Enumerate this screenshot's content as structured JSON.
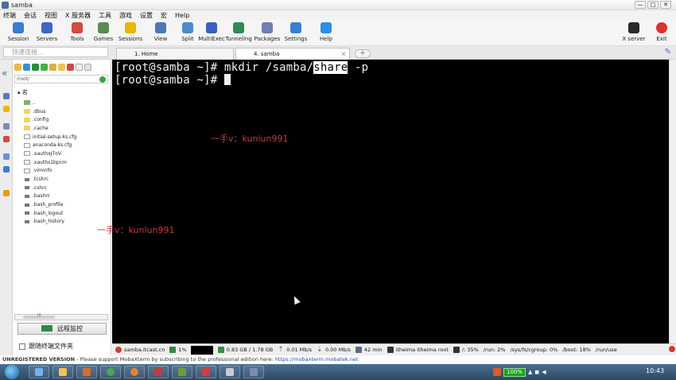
{
  "window": {
    "title": "samba",
    "minimize": "—",
    "maximize": "□",
    "close": "✕"
  },
  "menu": [
    "终端",
    "会话",
    "视图",
    "X 服务器",
    "工具",
    "游戏",
    "设置",
    "宏",
    "Help"
  ],
  "toolbar": {
    "items": [
      {
        "label": "Session",
        "color": "#3a7bd5"
      },
      {
        "label": "Servers",
        "color": "#3f66c8"
      },
      {
        "label": "Tools",
        "color": "#d24b3b"
      },
      {
        "label": "Games",
        "color": "#5a8a52"
      },
      {
        "label": "Sessions",
        "color": "#f0b400"
      },
      {
        "label": "View",
        "color": "#4d77b8"
      },
      {
        "label": "Split",
        "color": "#4a8bd0"
      },
      {
        "label": "MultiExec",
        "color": "#3d5ec2"
      },
      {
        "label": "Tunneling",
        "color": "#2e8b57"
      },
      {
        "label": "Packages",
        "color": "#6d7fb5"
      },
      {
        "label": "Settings",
        "color": "#3b7ed3"
      },
      {
        "label": "Help",
        "color": "#2c8ee8"
      }
    ],
    "right": [
      {
        "label": "X server",
        "color": "#2a2a2a"
      },
      {
        "label": "Exit",
        "color": "#e0312a"
      }
    ]
  },
  "quick_connect": {
    "placeholder": "快速连接..."
  },
  "tabs": [
    {
      "label": "1. Home",
      "active": false
    },
    {
      "label": "4. samba",
      "active": true,
      "close": "×"
    }
  ],
  "sidebar": {
    "path": "/root/",
    "column": "名",
    "files": [
      {
        "name": "..",
        "type": "up"
      },
      {
        "name": ".dbus",
        "type": "folder"
      },
      {
        "name": ".config",
        "type": "folder"
      },
      {
        "name": ".cache",
        "type": "folder"
      },
      {
        "name": "initial-setup-ks.cfg",
        "type": "doc"
      },
      {
        "name": "anaconda-ks.cfg",
        "type": "doc"
      },
      {
        "name": ".xauthxJ7oV",
        "type": "doc"
      },
      {
        "name": ".xauths1bpcm",
        "type": "doc"
      },
      {
        "name": ".viminfo",
        "type": "doc"
      },
      {
        "name": ".tcshrc",
        "type": "dot"
      },
      {
        "name": ".cshrc",
        "type": "dot"
      },
      {
        "name": ".bashrc",
        "type": "dot"
      },
      {
        "name": ".bash_profile",
        "type": "dot"
      },
      {
        "name": ".bash_logout",
        "type": "dot"
      },
      {
        "name": ".bash_history",
        "type": "dot"
      }
    ],
    "scroll_label": "III",
    "monitor_button": "远程监控",
    "follow_label": "跟随终端文件夹"
  },
  "terminal": {
    "line1_prefix": "[root@samba ~]# mkdir /samba/",
    "line1_selected": "share",
    "line1_suffix": " -p",
    "line2_prefix": "[root@samba ~]# "
  },
  "watermarks": [
    "一手v：kunlun991",
    "一手v：kunlun991"
  ],
  "status": {
    "host": "samba.itcast.cn",
    "cpu": "1%",
    "memory": "0.83 GB / 1.78 GB",
    "upload": "0.01 Mb/s",
    "download": "0.00 Mb/s",
    "uptime": "42 min",
    "users": "itheima  itheima  root",
    "disk1": "/: 35%",
    "disk2": "/run: 2%",
    "disk3": "/sys/fs/cgroup: 0%",
    "disk4": "/boot: 18%",
    "disk5": "/run/use"
  },
  "notice": {
    "bold": "UNREGISTERED VERSION",
    "text": " -  Please support MobaXterm by subscribing to the professional edition here:",
    "link": "https://mobaxterm.mobatek.net"
  },
  "taskbar": {
    "battery": "100%",
    "clock": "10:43"
  }
}
